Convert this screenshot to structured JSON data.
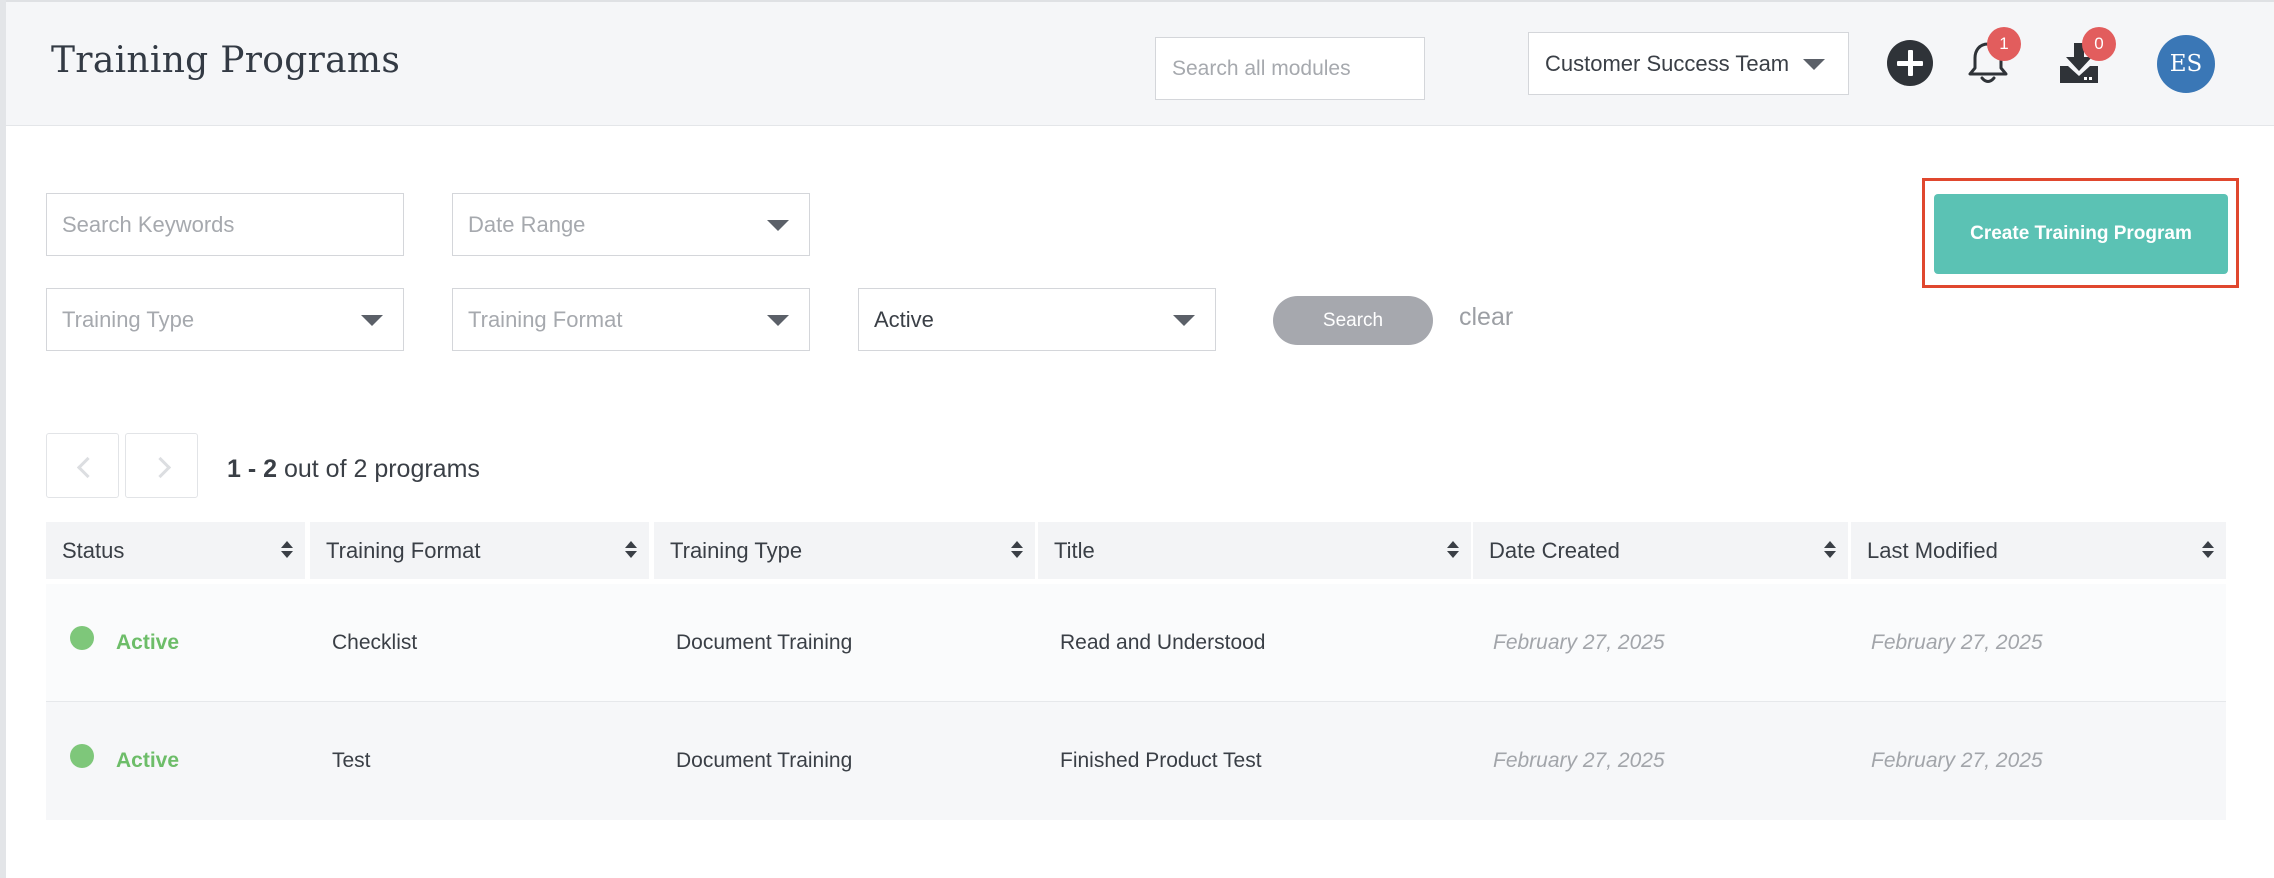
{
  "header": {
    "title": "Training Programs",
    "search_placeholder": "Search all modules",
    "team_selected": "Customer Success Team",
    "notifications_count": "1",
    "downloads_count": "0",
    "avatar_initials": "ES"
  },
  "filters": {
    "keywords_placeholder": "Search Keywords",
    "date_range_placeholder": "Date Range",
    "training_type_placeholder": "Training Type",
    "training_format_placeholder": "Training Format",
    "status_value": "Active",
    "search_label": "Search",
    "clear_label": "clear"
  },
  "actions": {
    "create_label": "Create Training Program"
  },
  "pagination": {
    "range": "1 - 2",
    "suffix": " out of 2 programs"
  },
  "table": {
    "columns": [
      "Status",
      "Training Format",
      "Training Type",
      "Title",
      "Date Created",
      "Last Modified"
    ],
    "rows": [
      {
        "status": "Active",
        "training_format": "Checklist",
        "training_type": "Document Training",
        "title": "Read and Understood",
        "date_created": "February 27, 2025",
        "last_modified": "February 27, 2025"
      },
      {
        "status": "Active",
        "training_format": "Test",
        "training_type": "Document Training",
        "title": "Finished Product Test",
        "date_created": "February 27, 2025",
        "last_modified": "February 27, 2025"
      }
    ]
  },
  "colors": {
    "accent": "#5bc2b4",
    "highlight_outline": "#e0472e",
    "status_active": "#6dbd69",
    "badge": "#e25d5d",
    "avatar": "#3a77b6"
  },
  "icons": {
    "add": "plus-circle-icon",
    "notifications": "bell-icon",
    "downloads": "download-tray-icon",
    "dropdown": "caret-down-icon",
    "sort": "sort-icon",
    "prev": "chevron-left-icon",
    "next": "chevron-right-icon"
  }
}
